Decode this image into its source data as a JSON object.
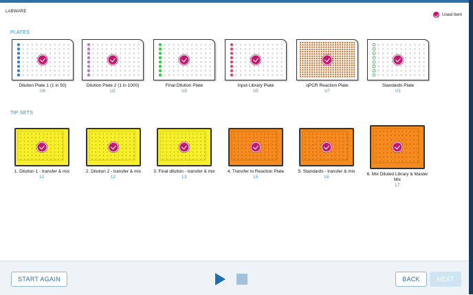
{
  "header": {
    "title": "LABWARE"
  },
  "legend": {
    "label": "Used item"
  },
  "sections": {
    "plates": "PLATES",
    "tips": "TIP SETS"
  },
  "plates": [
    {
      "name": "Dilution Plate 1 (1 in 50)",
      "location": "U6",
      "type": "col1",
      "dot_color": "#3a7fd5"
    },
    {
      "name": "Dilution Plate 2 (1 in 1000)",
      "location": "U2",
      "type": "col1",
      "dot_color": "#b27bc4"
    },
    {
      "name": "Final Dilution Plate",
      "location": "U3",
      "type": "col1",
      "dot_color": "#2ecc40"
    },
    {
      "name": "Input Library Plate",
      "location": "U5",
      "type": "col1",
      "dot_color": "#e0407a"
    },
    {
      "name": "qPCR Reaction Plate",
      "location": "U7",
      "type": "dense",
      "dot_color": "#c4702a"
    },
    {
      "name": "Standards Plate",
      "location": "U1",
      "type": "col1ring",
      "dot_color": "#4aa860"
    }
  ],
  "tips": [
    {
      "name": "1. Dilution 1 - transfer & mix",
      "location": "L1",
      "color": "#f7ef2a",
      "dot": "#b8a800",
      "tall": false
    },
    {
      "name": "2. Dilution 2 - transfer & mix",
      "location": "L2",
      "color": "#f7ef2a",
      "dot": "#b8a800",
      "tall": false
    },
    {
      "name": "3. Final dilution - transfer & mix",
      "location": "L3",
      "color": "#f7ef2a",
      "dot": "#b8a800",
      "tall": false
    },
    {
      "name": "4. Transfer to Reaction Plate",
      "location": "L5",
      "color": "#f58a1f",
      "dot": "#c85a00",
      "tall": false
    },
    {
      "name": "5. Standards - transfer & mix",
      "location": "L6",
      "color": "#f58a1f",
      "dot": "#c85a00",
      "tall": false
    },
    {
      "name": "6. Mix Diluted Library & Master Mix",
      "location": "L7",
      "color": "#f58a1f",
      "dot": "#c85a00",
      "tall": true
    }
  ],
  "footer": {
    "start_again": "START AGAIN",
    "back": "BACK",
    "next": "NEXT"
  }
}
